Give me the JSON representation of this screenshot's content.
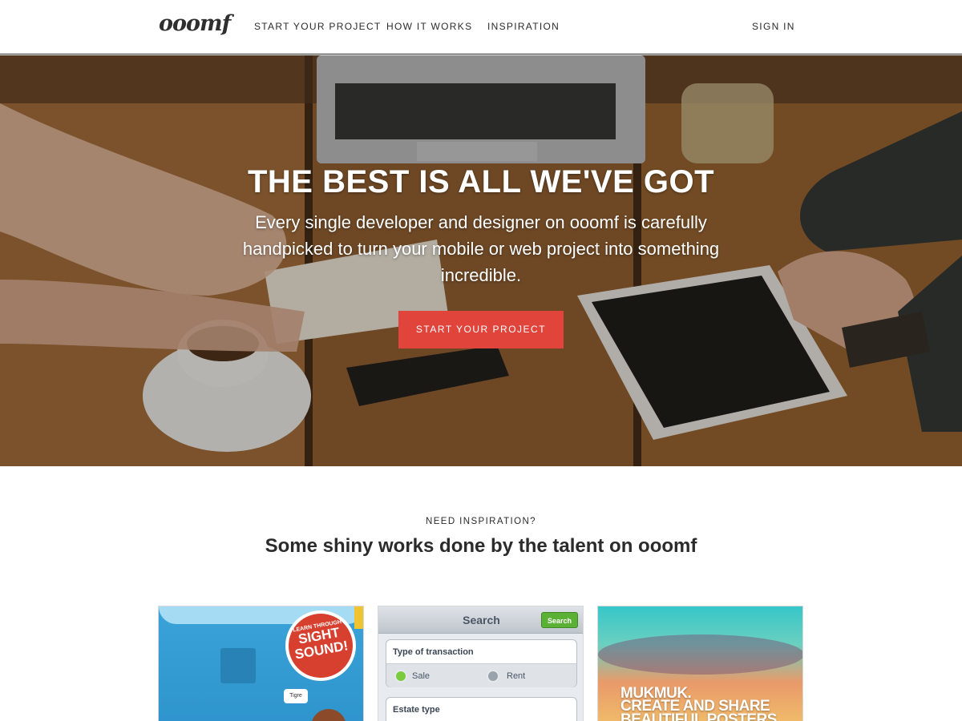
{
  "nav": {
    "logo": "ooomf",
    "links": [
      "START YOUR PROJECT",
      "HOW IT WORKS",
      "INSPIRATION"
    ],
    "sign_in": "SIGN IN"
  },
  "hero": {
    "title": "THE BEST IS ALL WE'VE GOT",
    "subtitle": "Every single developer and designer on ooomf is carefully handpicked to turn your mobile or web project into something incredible.",
    "cta": "START YOUR PROJECT"
  },
  "inspiration": {
    "eyebrow": "NEED INSPIRATION?",
    "title": "Some shiny works done by the talent on ooomf"
  },
  "cards": {
    "card1": {
      "badge_small": "LEARN THROUGH",
      "badge_line1": "SIGHT",
      "badge_line2": "SOUND!",
      "bubble": "Tigre"
    },
    "card2": {
      "title": "Search",
      "button": "Search",
      "group1_label": "Type of transaction",
      "option_sale": "Sale",
      "option_rent": "Rent",
      "group2_label": "Estate type"
    },
    "card3": {
      "line1": "MUKMUK.",
      "line2": "CREATE AND SHARE",
      "line3": "BEAUTIFUL POSTERS"
    }
  },
  "colors": {
    "accent": "#e0443b",
    "text": "#2b2b2b"
  }
}
